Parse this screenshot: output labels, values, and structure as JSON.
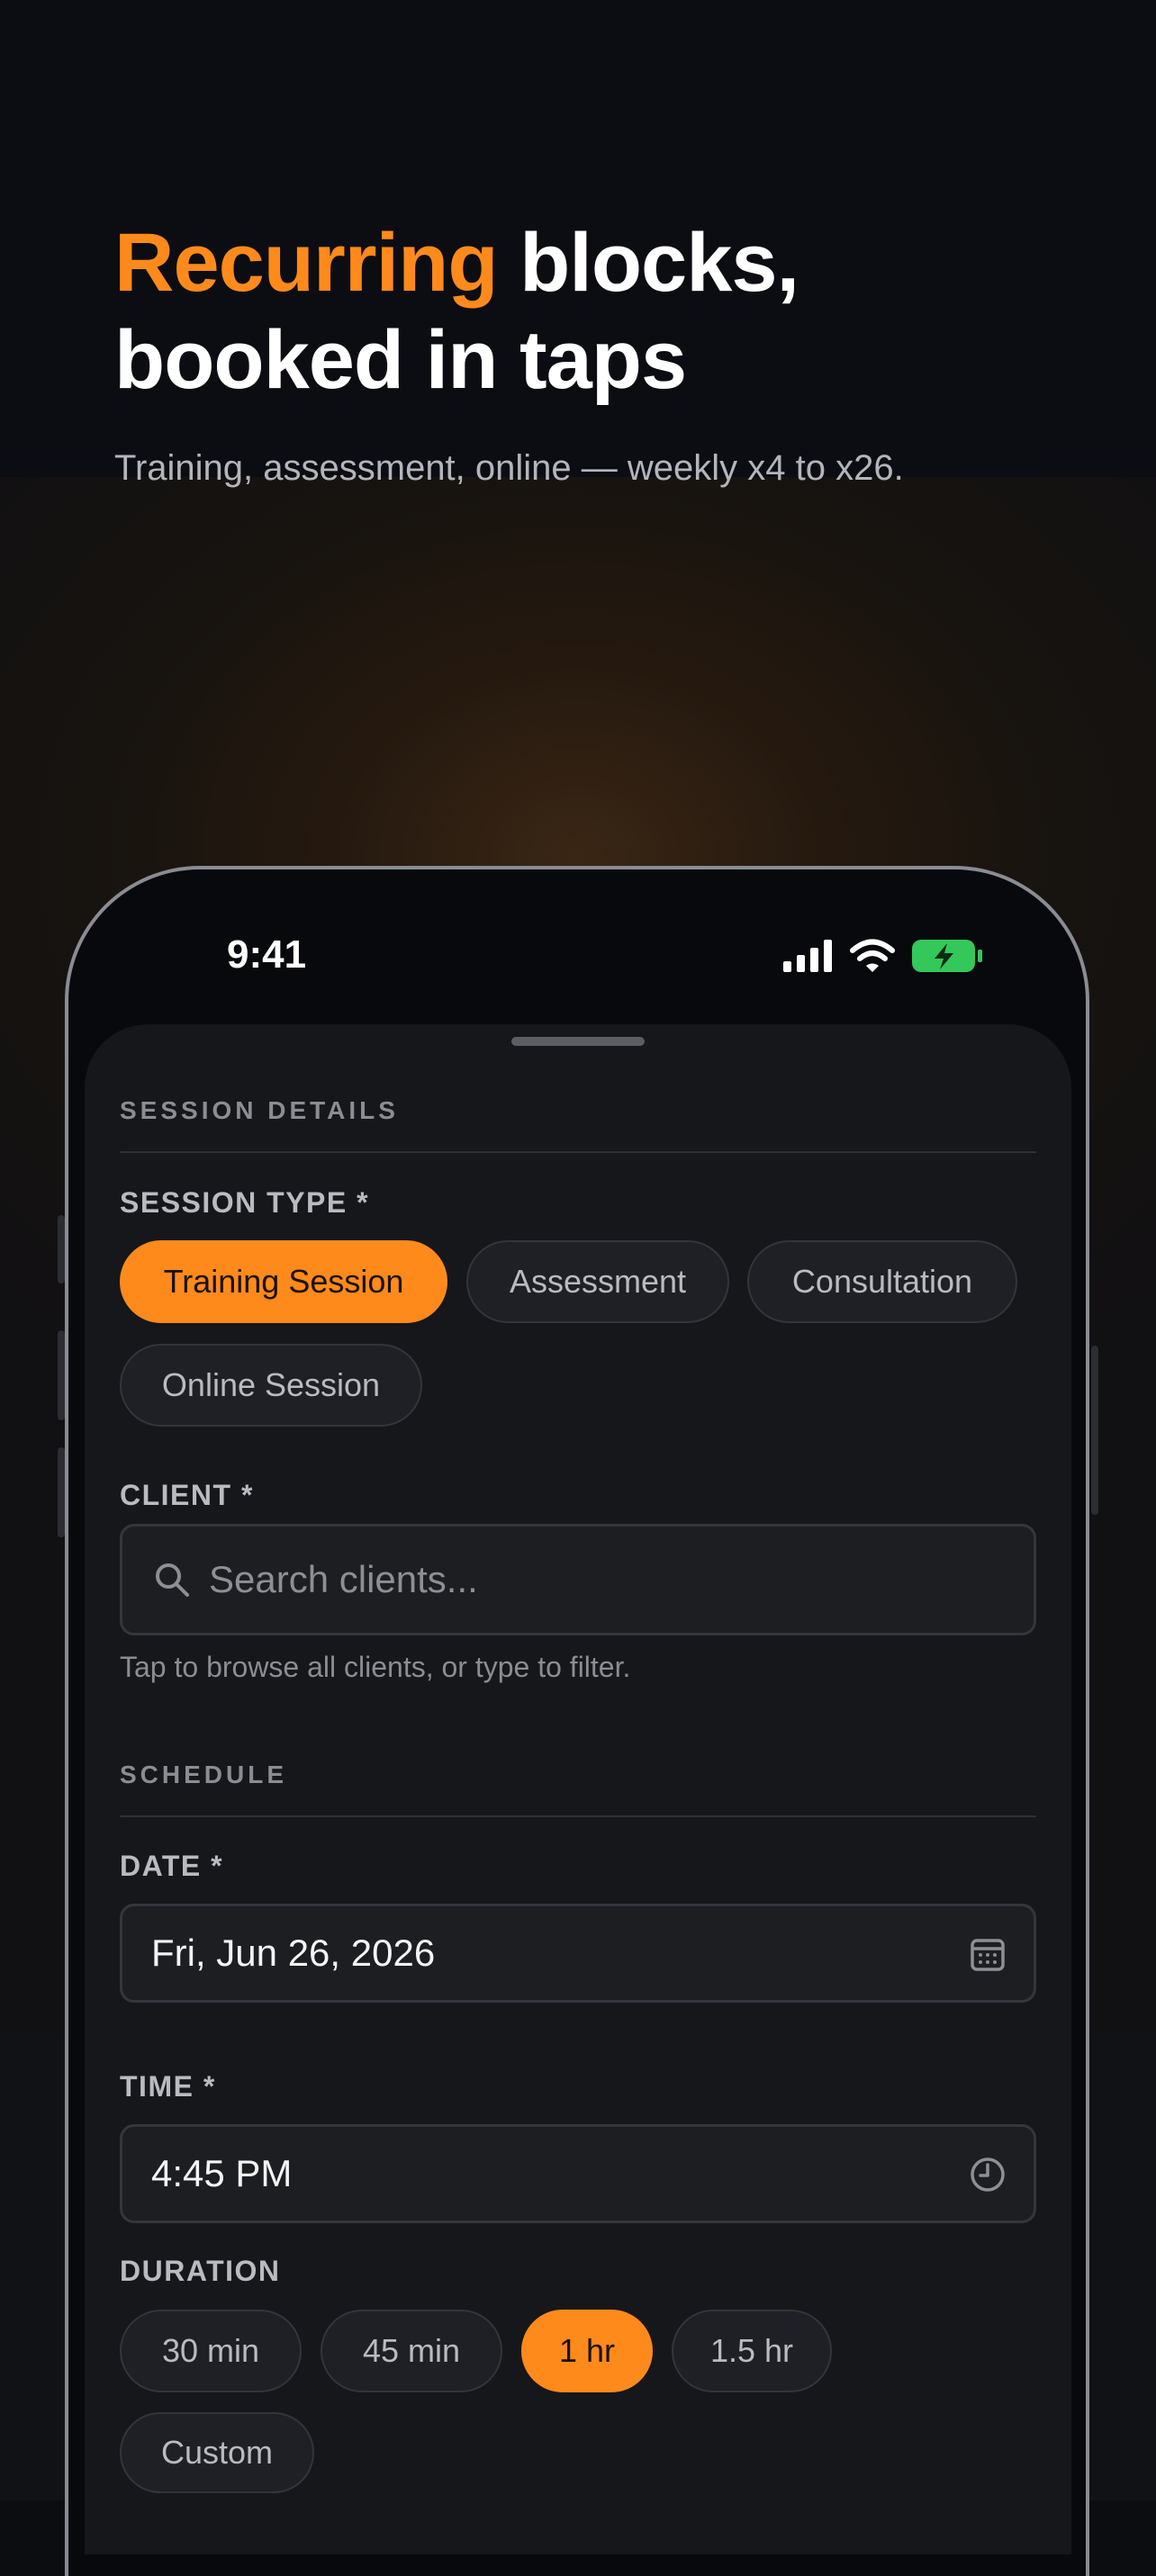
{
  "hero": {
    "headline_accent": "Recurring",
    "headline_rest": " blocks, booked in taps",
    "subheadline": "Training, assessment, online — weekly x4 to x26."
  },
  "status_bar": {
    "time": "9:41"
  },
  "session_details": {
    "section_title": "SESSION DETAILS",
    "session_type_label": "SESSION TYPE *",
    "session_types": [
      {
        "label": "Training Session",
        "selected": true
      },
      {
        "label": "Assessment",
        "selected": false
      },
      {
        "label": "Consultation",
        "selected": false
      },
      {
        "label": "Online Session",
        "selected": false
      }
    ],
    "client_label": "CLIENT *",
    "client_placeholder": "Search clients...",
    "client_helper": "Tap to browse all clients, or type to filter."
  },
  "schedule": {
    "section_title": "SCHEDULE",
    "date_label": "DATE *",
    "date_value": "Fri, Jun 26, 2026",
    "time_label": "TIME *",
    "time_value": "4:45 PM",
    "duration_label": "DURATION",
    "durations": [
      {
        "label": "30 min",
        "selected": false
      },
      {
        "label": "45 min",
        "selected": false
      },
      {
        "label": "1 hr",
        "selected": true
      },
      {
        "label": "1.5 hr",
        "selected": false
      },
      {
        "label": "Custom",
        "selected": false
      }
    ]
  },
  "colors": {
    "accent": "#ff8a1c",
    "background": "#0c0d11",
    "sheet": "#16171b",
    "battery": "#34c759"
  }
}
